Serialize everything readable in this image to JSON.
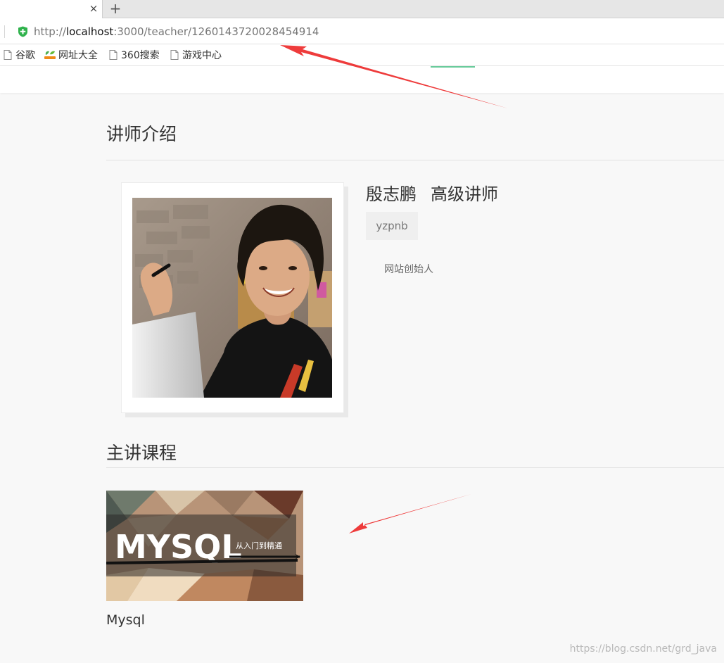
{
  "browser": {
    "tab_close": "×",
    "new_tab": "+",
    "url_prefix": "http://",
    "url_host": "localhost",
    "url_path": ":3000/teacher/1260143720028454914",
    "bookmarks": [
      {
        "label": "谷歌",
        "icon": "page-icon"
      },
      {
        "label": "网址大全",
        "icon": "hao-icon"
      },
      {
        "label": "360搜索",
        "icon": "page-icon"
      },
      {
        "label": "游戏中心",
        "icon": "page-icon"
      }
    ]
  },
  "teacher_section": {
    "title": "讲师介绍",
    "name": "殷志鹏",
    "level": "高级讲师",
    "tag": "yzpnb",
    "intro": "网站创始人"
  },
  "courses_section": {
    "title": "主讲课程",
    "courses": [
      {
        "name": "Mysql",
        "cover_title": "MYSQL",
        "cover_subtitle": "从入门到精通"
      }
    ]
  },
  "watermark": "https://blog.csdn.net/grd_java",
  "colors": {
    "accent": "#68cb9b",
    "annotation_arrow": "#ee3b3b",
    "page_background": "#f8f8f8"
  }
}
